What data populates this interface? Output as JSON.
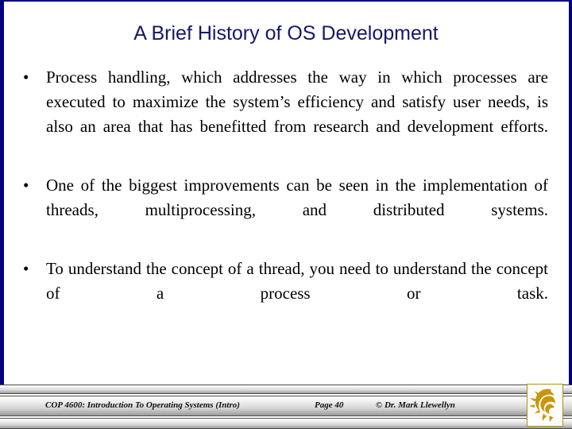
{
  "slide": {
    "title": "A Brief History of OS Development",
    "accent_color": "#16166b",
    "border_color": "#000080",
    "background_color": "#ffffff",
    "bullets": [
      {
        "marker": "•",
        "text": "Process handling, which addresses the way in which processes are executed to maximize the system’s efficiency and satisfy user needs, is also an area that has benefitted from research and development efforts."
      },
      {
        "marker": "•",
        "text": "One of the biggest improvements can be seen in the implementation of threads, multiprocessing, and distributed systems."
      },
      {
        "marker": "•",
        "text": "To understand the concept of a thread, you need to understand the concept of a process or task."
      }
    ]
  },
  "footer": {
    "course": "COP 4600: Introduction To Operating Systems (Intro)",
    "page": "Page 40",
    "copyright": "© Dr. Mark Llewellyn",
    "logo_name": "ucf-pegasus-logo",
    "logo_color": "#c8960c"
  }
}
